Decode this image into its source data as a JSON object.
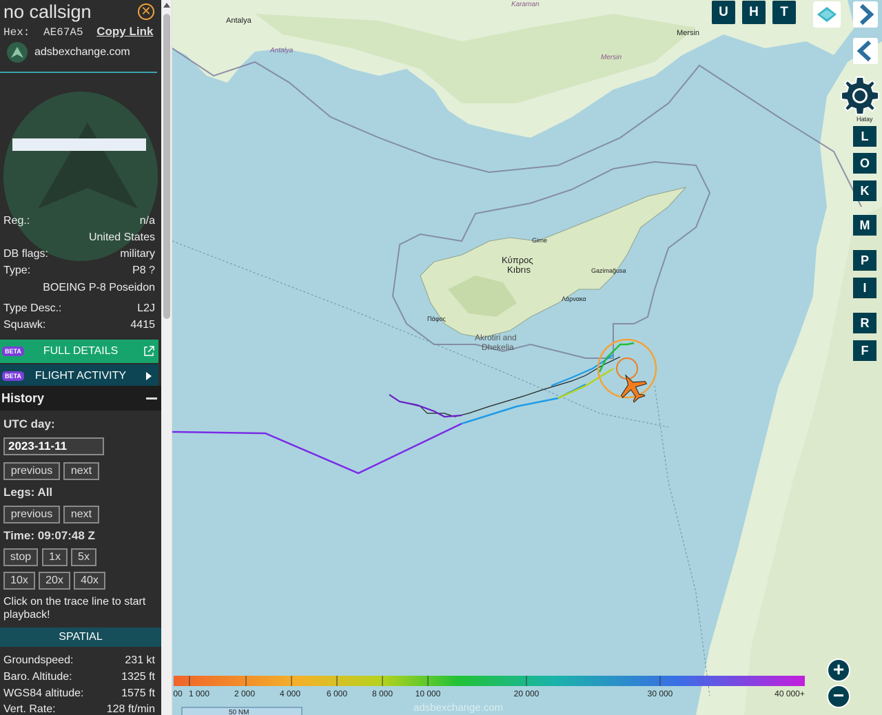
{
  "aircraft": {
    "callsign": "no callsign",
    "hex_label": "Hex:",
    "hex": "AE67A5",
    "copy_link": "Copy Link",
    "site": "adsbexchange.com",
    "reg_label": "Reg.:",
    "reg": "n/a",
    "country": "United States",
    "dbflags_label": "DB flags:",
    "dbflags": "military",
    "type_label": "Type:",
    "type": "P8 ?",
    "type_name": "BOEING P-8 Poseidon",
    "type_desc_label": "Type Desc.:",
    "type_desc": "L2J",
    "squawk_label": "Squawk:",
    "squawk": "4415"
  },
  "buttons": {
    "beta": "BETA",
    "full_details": "FULL DETAILS",
    "flight_activity": "FLIGHT ACTIVITY"
  },
  "history": {
    "title": "History",
    "utc_label": "UTC day:",
    "date": "2023-11-11",
    "previous": "previous",
    "next": "next",
    "legs": "Legs: All",
    "time": "Time: 09:07:48 Z",
    "stop": "stop",
    "speeds": [
      "1x",
      "5x",
      "10x",
      "20x",
      "40x"
    ],
    "help": "Click on the trace line to start playback!"
  },
  "spatial": {
    "title": "SPATIAL",
    "gs_label": "Groundspeed:",
    "gs": "231 kt",
    "baro_label": "Baro. Altitude:",
    "baro": "1325 ft",
    "wgs_label": "WGS84 altitude:",
    "wgs": "1575 ft",
    "vr_label": "Vert. Rate:",
    "vr": "128 ft/min"
  },
  "toolbar": {
    "top": [
      "U",
      "H",
      "T"
    ],
    "side": [
      "L",
      "O",
      "K",
      "M",
      "P",
      "I",
      "R",
      "F"
    ]
  },
  "map_labels": {
    "antalya": "Antalya",
    "antalya_region": "Antalya",
    "mersin": "Mersin",
    "mersin_region": "Mersin",
    "karaman": "Karaman",
    "hatay": "Hatay",
    "girne": "Girne",
    "kypros": "Κύπρος",
    "kibris": "Kıbrıs",
    "gazimagusa": "Gazimağusa",
    "larnaka": "Λάρνακα",
    "pafos": "Πάφος",
    "akrotiri": "Akrotiri and",
    "dhekelia": "Dhekelia",
    "watermark": "adsbexchange.com",
    "scale": "50 NM"
  },
  "altitude_legend": [
    "00",
    "1 000",
    "2 000",
    "4 000",
    "6 000",
    "8 000",
    "10 000",
    "20 000",
    "30 000",
    "40 000+"
  ],
  "colors": {
    "accent": "#f3a23a",
    "tile": "#003f4f",
    "trace_purple": "#7a2be6",
    "aircraft": "#f07d1f"
  }
}
